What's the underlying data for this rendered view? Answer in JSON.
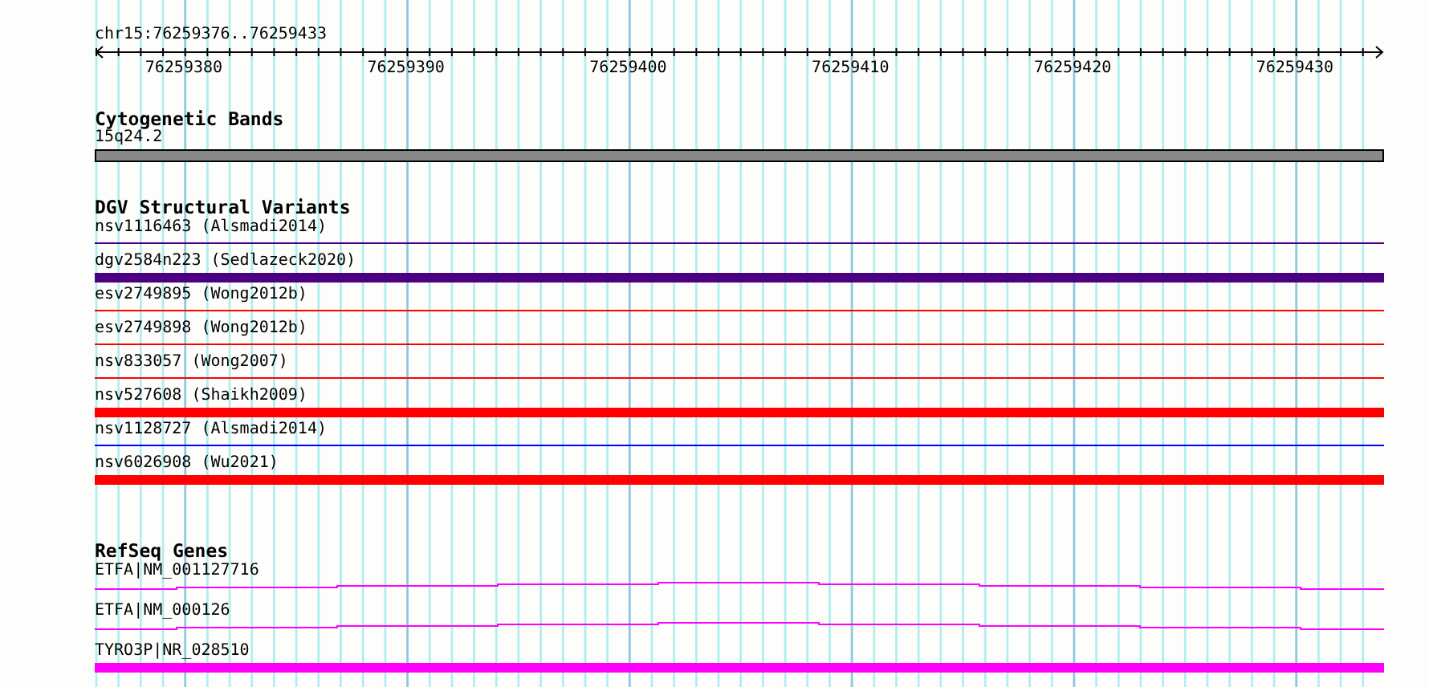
{
  "ruler": {
    "location": "chr15:76259376..76259433",
    "ticks": [
      "76259380",
      "76259390",
      "76259400",
      "76259410",
      "76259420",
      "76259430"
    ]
  },
  "cytogenetic_bands": {
    "title": "Cytogenetic Bands",
    "items": [
      {
        "name": "15q24.2",
        "color": "#888888"
      }
    ]
  },
  "dgv_structural_variants": {
    "title": "DGV Structural Variants",
    "items": [
      {
        "name": "nsv1116463 (Alsmadi2014)",
        "kind": "thin",
        "color": "#4b0082"
      },
      {
        "name": "dgv2584n223 (Sedlazeck2020)",
        "kind": "thick",
        "color": "#4b0082"
      },
      {
        "name": "esv2749895 (Wong2012b)",
        "kind": "thin",
        "color": "#ff0000"
      },
      {
        "name": "esv2749898 (Wong2012b)",
        "kind": "thin",
        "color": "#ff0000"
      },
      {
        "name": "nsv833057 (Wong2007)",
        "kind": "thin",
        "color": "#ff0000"
      },
      {
        "name": "nsv527608 (Shaikh2009)",
        "kind": "thick",
        "color": "#ff0000"
      },
      {
        "name": "nsv1128727 (Alsmadi2014)",
        "kind": "thin",
        "color": "#0000ff"
      },
      {
        "name": "nsv6026908 (Wu2021)",
        "kind": "thick",
        "color": "#ff0000"
      }
    ]
  },
  "refseq_genes": {
    "title": "RefSeq Genes",
    "items": [
      {
        "name": "ETFA|NM_001127716",
        "kind": "stepped"
      },
      {
        "name": "ETFA|NM_000126",
        "kind": "stepped"
      },
      {
        "name": "TYRO3P|NR_028510",
        "kind": "thick"
      }
    ]
  }
}
